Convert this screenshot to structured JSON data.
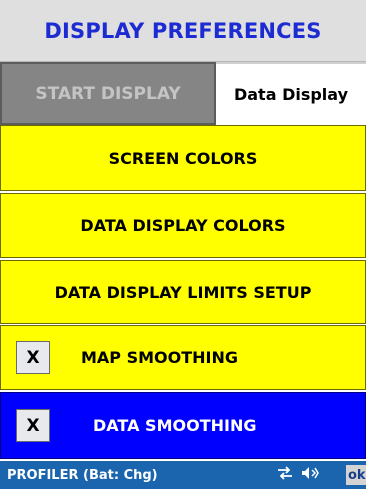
{
  "title": "DISPLAY PREFERENCES",
  "tabs": {
    "start": "START DISPLAY",
    "data": "Data Display"
  },
  "buttons": {
    "screen_colors": "SCREEN COLORS",
    "data_display_colors": "DATA DISPLAY COLORS",
    "limits_setup": "DATA DISPLAY LIMITS SETUP"
  },
  "options": {
    "map_smoothing": {
      "label": "MAP SMOOTHING",
      "mark": "X"
    },
    "data_smoothing": {
      "label": "DATA SMOOTHING",
      "mark": "X"
    }
  },
  "status": {
    "text": "PROFILER (Bat: Chg)",
    "ok": "ok",
    "icons": [
      "connectivity-icon",
      "volume-icon"
    ]
  },
  "colors": {
    "title_text": "#1d2bd3",
    "yellow": "#ffff00",
    "blue": "#0000ff",
    "status_bar": "#1a65ad"
  }
}
